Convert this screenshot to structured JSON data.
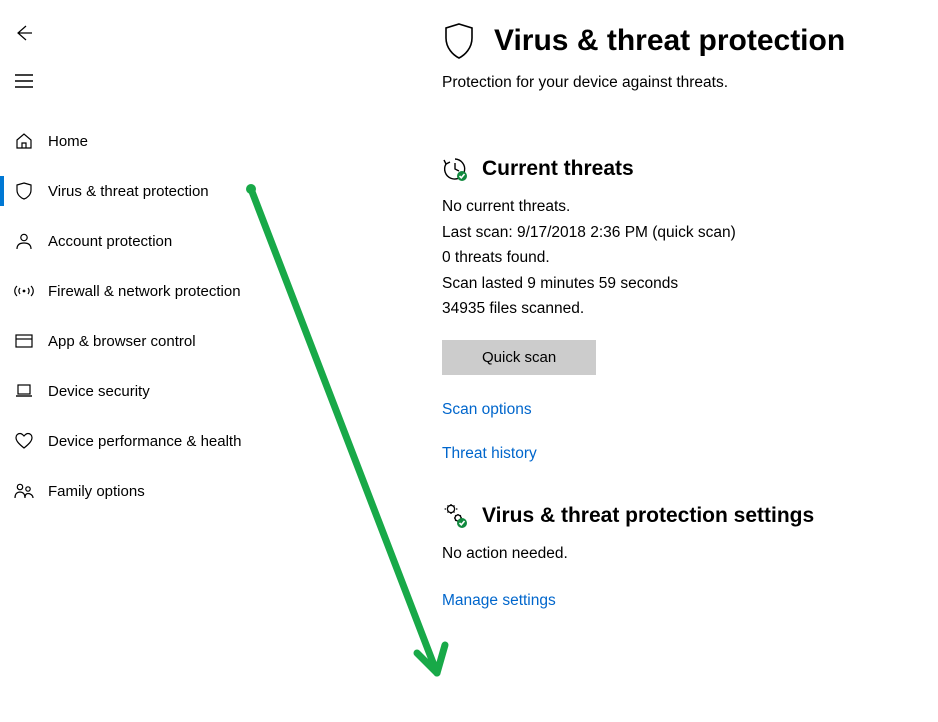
{
  "nav": {
    "items": [
      {
        "label": "Home"
      },
      {
        "label": "Virus & threat protection"
      },
      {
        "label": "Account protection"
      },
      {
        "label": "Firewall & network protection"
      },
      {
        "label": "App & browser control"
      },
      {
        "label": "Device security"
      },
      {
        "label": "Device performance & health"
      },
      {
        "label": "Family options"
      }
    ]
  },
  "page": {
    "title": "Virus & threat protection",
    "subtitle": "Protection for your device against threats."
  },
  "threats": {
    "heading": "Current threats",
    "none": "No current threats.",
    "last_scan": "Last scan: 9/17/2018 2:36 PM (quick scan)",
    "found": "0 threats found.",
    "duration": "Scan lasted 9 minutes 59 seconds",
    "files": "34935 files scanned.",
    "button": "Quick scan",
    "link_options": "Scan options",
    "link_history": "Threat history"
  },
  "settings": {
    "heading": "Virus & threat protection settings",
    "status": "No action needed.",
    "link": "Manage settings"
  }
}
